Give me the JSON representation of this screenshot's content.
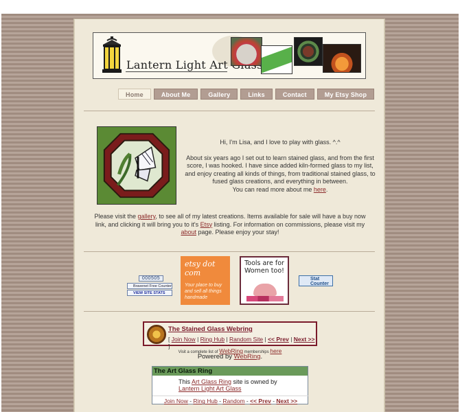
{
  "site": {
    "name": "Lantern Light Art Glass"
  },
  "nav": [
    {
      "label": "Home",
      "active": true
    },
    {
      "label": "About Me"
    },
    {
      "label": "Gallery"
    },
    {
      "label": "Links"
    },
    {
      "label": "Contact"
    },
    {
      "label": "My Etsy Shop"
    }
  ],
  "intro": {
    "greeting": "Hi, I'm Lisa, and I love to play with glass. ^.^",
    "para1": "About six years ago I set out to learn stained glass, and from the first score, I was hooked. I have since added kiln-formed glass to my list, and enjoy creating all kinds of things, from traditional stained glass, to fused glass creations, and everything in between.",
    "more_prefix": "You can read more about me ",
    "more_link": "here",
    "more_suffix": "."
  },
  "visit": {
    "p1": "Please visit the ",
    "gallery_link": "gallery",
    "p2": ", to see all of my latest creations. Items available for sale will have a buy now link, and clicking it will bring you to it's ",
    "etsy_link": "Etsy",
    "p3": " listing. For information on commissions, please visit my ",
    "about_link": "about",
    "p4": " page. Please enjoy your stay!"
  },
  "badges": {
    "counter": "000505",
    "bravenet": "Bravenet Free Counter",
    "sitestats": "VIEW SITE STATS",
    "etsy_brand": "etsy dot com",
    "etsy_tag": "Your place to buy and sell all things handmade",
    "tools": "Tools are for Women too!",
    "statcounter": "Stat Counter"
  },
  "webring": {
    "title": "The Stained Glass Webring",
    "join": "Join Now",
    "hub": "Ring Hub",
    "random": "Random Site",
    "prev": "<< Prev",
    "next": "Next >>",
    "complete_prefix": "Visit a complete list of ",
    "complete_link": "WebRing",
    "complete_mid": " memberships ",
    "complete_here": "here",
    "powered_prefix": "Powered by ",
    "powered_link": "WebRing",
    "powered_suffix": "."
  },
  "artring": {
    "title": "The Art Glass Ring",
    "body_prefix": "This ",
    "ring_link": "Art Glass Ring",
    "body_mid": " site is owned by",
    "owner_link": "Lantern Light Art Glass",
    "join": "Join Now",
    "hub": "Ring Hub",
    "random": "Random",
    "prev": "<< Prev",
    "next": "Next >>"
  }
}
